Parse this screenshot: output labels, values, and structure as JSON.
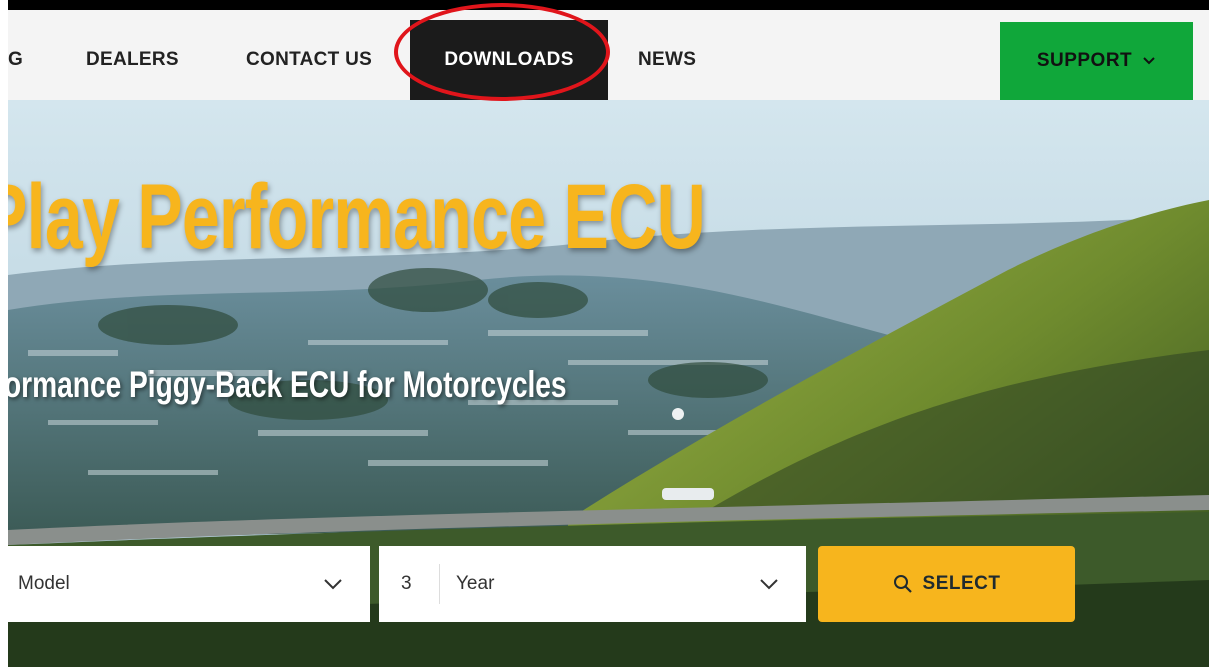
{
  "nav": {
    "items": [
      {
        "label": "G"
      },
      {
        "label": "DEALERS"
      },
      {
        "label": "CONTACT US"
      },
      {
        "label": "DOWNLOADS"
      },
      {
        "label": "NEWS"
      }
    ],
    "support_label": "SUPPORT",
    "support_icon": "chevron-down-icon",
    "highlighted_item": "DOWNLOADS",
    "highlight_color": "#e0151b"
  },
  "hero": {
    "title": "Play Performance ECU",
    "subtitle": "ormance Piggy-Back ECU for Motorcycles"
  },
  "search": {
    "model_placeholder": "Model",
    "year_number": "3",
    "year_placeholder": "Year",
    "select_label": "SELECT",
    "select_icon": "search-icon"
  },
  "colors": {
    "accent": "#f7b51d",
    "support_green": "#10a73a",
    "nav_active": "#1b1b1b"
  }
}
